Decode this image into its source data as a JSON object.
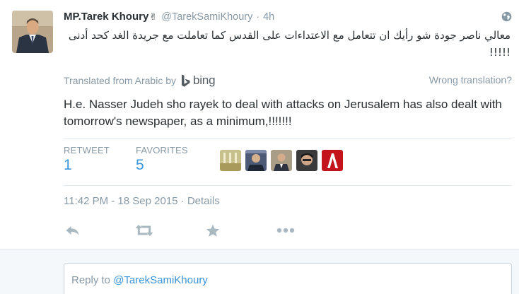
{
  "tweet": {
    "fullname": "MP.Tarek Khoury",
    "fullname_emoji": "✌",
    "username": "@TarekSamiKhoury",
    "separator": "·",
    "time": "4h",
    "arabic_text": "معالي ناصر جودة شو رأيك ان تتعامل مع الاعتداءات على القدس كما تعاملت مع جريدة الغد كحد أدنى !!!!!",
    "translated_label": "Translated from Arabic by",
    "bing_label": "bing",
    "wrong_translation": "Wrong translation?",
    "translation": "H.e. Nasser Judeh sho rayek to deal with attacks on Jerusalem has also dealt with tomorrow's newspaper, as a minimum,!!!!!!!",
    "stats": {
      "retweet_label": "RETWEET",
      "retweet_count": "1",
      "favorites_label": "FAVORITES",
      "favorites_count": "5"
    },
    "timestamp": "11:42 PM - 18 Sep 2015",
    "timestamp_sep": "·",
    "details": "Details",
    "actions": [
      "reply-icon",
      "retweet-icon",
      "favorite-icon",
      "more-icon"
    ]
  },
  "reply": {
    "prefix": "Reply to",
    "mention": "@TarekSamiKhoury"
  },
  "colors": {
    "link_blue": "#3b94d9",
    "muted_gray": "#8899a6",
    "text_dark": "#292f33",
    "border": "#e1e8ed",
    "icon_gray": "#aab8c2"
  }
}
